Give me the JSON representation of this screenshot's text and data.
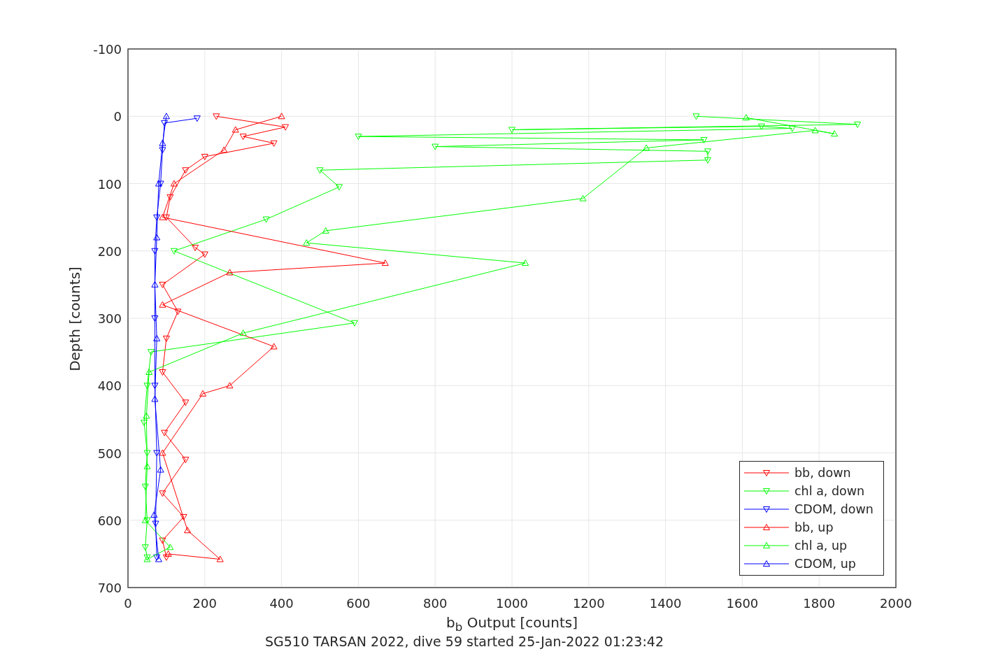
{
  "chart_data": {
    "type": "line",
    "xlabel": "b$_{b}$ Output [counts]",
    "ylabel": "Depth [counts]",
    "title": "SG510 TARSAN 2022, dive 59 started 25-Jan-2022 01:23:42",
    "xlim": [
      0,
      2000
    ],
    "ylim": [
      700,
      -100
    ],
    "grid": true,
    "xticks": [
      {
        "value": 0,
        "label": "0"
      },
      {
        "value": 200,
        "label": "200"
      },
      {
        "value": 400,
        "label": "400"
      },
      {
        "value": 600,
        "label": "600"
      },
      {
        "value": 800,
        "label": "800"
      },
      {
        "value": 1000,
        "label": "1000"
      },
      {
        "value": 1200,
        "label": "1200"
      },
      {
        "value": 1400,
        "label": "1400"
      },
      {
        "value": 1600,
        "label": "1600"
      },
      {
        "value": 1800,
        "label": "1800"
      },
      {
        "value": 2000,
        "label": "2000"
      }
    ],
    "yticks": [
      {
        "value": -100,
        "label": "-100"
      },
      {
        "value": 0,
        "label": "0"
      },
      {
        "value": 100,
        "label": "100"
      },
      {
        "value": 200,
        "label": "200"
      },
      {
        "value": 300,
        "label": "300"
      },
      {
        "value": 400,
        "label": "400"
      },
      {
        "value": 500,
        "label": "500"
      },
      {
        "value": 600,
        "label": "600"
      },
      {
        "value": 700,
        "label": "700"
      }
    ],
    "series": [
      {
        "name": "bb, down",
        "color": "#ff0000",
        "marker": "triangle",
        "x": [
          230,
          410,
          300,
          380,
          200,
          150,
          110,
          100,
          175,
          200,
          90,
          130,
          100,
          90,
          150,
          95,
          150,
          90,
          145,
          90,
          100
        ],
        "values": [
          0,
          16,
          30,
          40,
          60,
          80,
          120,
          150,
          195,
          205,
          250,
          290,
          330,
          380,
          425,
          470,
          510,
          560,
          595,
          630,
          655
        ]
      },
      {
        "name": "chl a, down",
        "color": "#00ff00",
        "marker": "triangle",
        "x": [
          1480,
          1900,
          1000,
          1650,
          1730,
          600,
          1500,
          800,
          1510,
          1510,
          500,
          550,
          360,
          120,
          590,
          60,
          50,
          42,
          50,
          45,
          50,
          45,
          50
        ],
        "values": [
          0,
          12,
          20,
          15,
          18,
          30,
          35,
          45,
          52,
          65,
          80,
          105,
          153,
          200,
          307,
          350,
          400,
          455,
          500,
          550,
          600,
          640,
          655
        ]
      },
      {
        "name": "CDOM, down",
        "color": "#0000ff",
        "marker": "triangle",
        "x": [
          180,
          95,
          90,
          85,
          75,
          70,
          70,
          70,
          75,
          72,
          75
        ],
        "values": [
          3,
          10,
          50,
          100,
          150,
          200,
          300,
          400,
          500,
          605,
          655
        ]
      },
      {
        "name": "bb, up",
        "color": "#ff0000",
        "marker": "triangle",
        "x": [
          400,
          280,
          250,
          120,
          90,
          670,
          265,
          90,
          380,
          265,
          195,
          90,
          155,
          240,
          105
        ],
        "values": [
          0,
          20,
          50,
          100,
          150,
          218,
          232,
          280,
          342,
          400,
          412,
          500,
          615,
          658,
          650
        ]
      },
      {
        "name": "chl a, up",
        "color": "#00ff00",
        "marker": "triangle",
        "x": [
          1610,
          1840,
          1790,
          1350,
          1185,
          515,
          465,
          1035,
          300,
          55,
          48,
          50,
          45,
          110,
          50
        ],
        "values": [
          2,
          26,
          21,
          47,
          122,
          170,
          188,
          218,
          322,
          380,
          445,
          520,
          600,
          640,
          658
        ]
      },
      {
        "name": "CDOM, up",
        "color": "#0000ff",
        "marker": "triangle",
        "x": [
          100,
          90,
          80,
          75,
          70,
          75,
          70,
          85,
          68,
          80
        ],
        "values": [
          0,
          40,
          100,
          180,
          250,
          330,
          420,
          525,
          592,
          658
        ]
      }
    ]
  }
}
